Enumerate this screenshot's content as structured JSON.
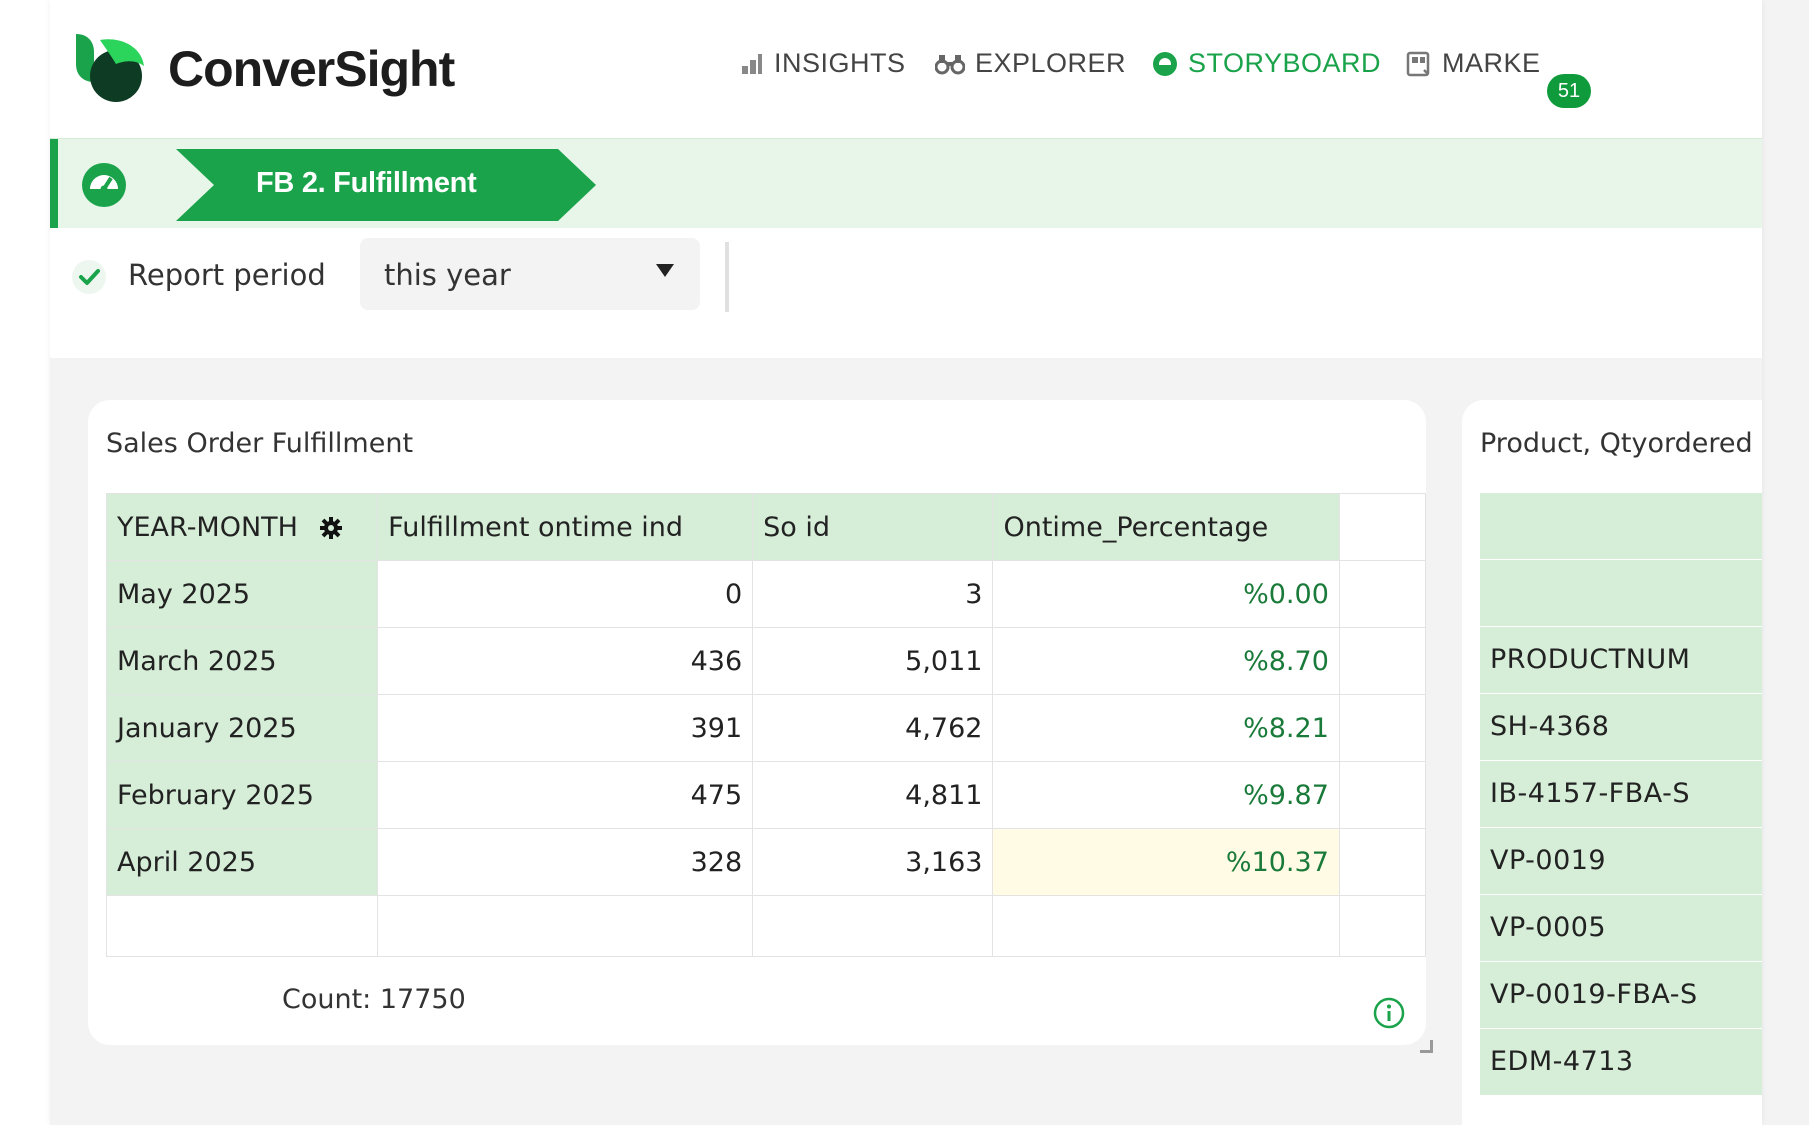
{
  "header": {
    "brand": "ConverSight",
    "nav": [
      {
        "label": "INSIGHTS",
        "icon": "bar-chart-icon"
      },
      {
        "label": "EXPLORER",
        "icon": "binoculars-icon"
      },
      {
        "label": "STORYBOARD",
        "icon": "storyboard-gauge-icon",
        "active": true,
        "badge": "51"
      },
      {
        "label": "MARKE",
        "icon": "marketplace-icon"
      }
    ],
    "accent_color": "#1aa34a"
  },
  "storyboard": {
    "title": "FB 2. Fulfillment",
    "icon": "gauge-icon"
  },
  "filter": {
    "label": "Report period",
    "checked": true,
    "selected": "this year"
  },
  "card": {
    "title": "Sales Order Fulfillment",
    "columns": [
      "YEAR-MONTH",
      "Fulfillment ontime ind",
      "So id",
      "Ontime_Percentage"
    ],
    "rows": [
      {
        "month": "May 2025",
        "ontime": "0",
        "soid": "3",
        "pct": "%0.00"
      },
      {
        "month": "March 2025",
        "ontime": "436",
        "soid": "5,011",
        "pct": "%8.70"
      },
      {
        "month": "January 2025",
        "ontime": "391",
        "soid": "4,762",
        "pct": "%8.21"
      },
      {
        "month": "February 2025",
        "ontime": "475",
        "soid": "4,811",
        "pct": "%9.87"
      },
      {
        "month": "April 2025",
        "ontime": "328",
        "soid": "3,163",
        "pct": "%10.37"
      }
    ],
    "count": "Count: 17750"
  },
  "card2": {
    "title": "Product, Qtyordered",
    "items": [
      "",
      "",
      "PRODUCTNUM",
      "SH-4368",
      "IB-4157-FBA-S",
      "VP-0019",
      "VP-0005",
      "VP-0019-FBA-S",
      "EDM-4713"
    ]
  }
}
